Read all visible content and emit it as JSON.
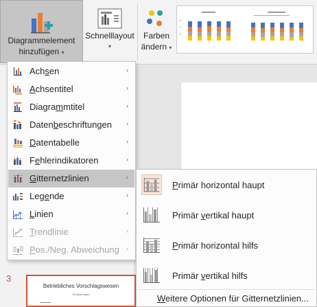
{
  "ribbon": {
    "add_element": {
      "line1": "Diagrammelement",
      "line2": "hinzufügen"
    },
    "quick_layout": {
      "line1": "Schnelllayout"
    },
    "change_colors": {
      "line1": "Farben",
      "line2": "ändern"
    },
    "colors": {
      "accent": "#d35230",
      "active_bg": "#c6c6c6",
      "blue": "#4472c4",
      "orange": "#ed7d31",
      "gray": "#a5a5a5",
      "yellow": "#ffc000",
      "teal": "#2e9f9f"
    }
  },
  "menu": {
    "items": [
      {
        "pre": "Ach",
        "u": "s",
        "post": "en",
        "icon": "axes-icon",
        "enabled": true
      },
      {
        "pre": "",
        "u": "A",
        "post": "chsentitel",
        "icon": "axis-titles-icon",
        "enabled": true
      },
      {
        "pre": "Diagra",
        "u": "m",
        "post": "mtitel",
        "icon": "chart-title-icon",
        "enabled": true
      },
      {
        "pre": "Daten",
        "u": "b",
        "post": "eschriftungen",
        "icon": "data-labels-icon",
        "enabled": true
      },
      {
        "pre": "",
        "u": "D",
        "post": "atentabelle",
        "icon": "data-table-icon",
        "enabled": true
      },
      {
        "pre": "F",
        "u": "e",
        "post": "hlerindikatoren",
        "icon": "error-bars-icon",
        "enabled": true
      },
      {
        "pre": "",
        "u": "G",
        "post": "itternetzlinien",
        "icon": "gridlines-icon",
        "enabled": true,
        "active": true
      },
      {
        "pre": "Leg",
        "u": "e",
        "post": "nde",
        "icon": "legend-icon",
        "enabled": true
      },
      {
        "pre": "",
        "u": "L",
        "post": "inien",
        "icon": "lines-icon",
        "enabled": true
      },
      {
        "pre": "",
        "u": "T",
        "post": "rendlinie",
        "icon": "trendline-icon",
        "enabled": false
      },
      {
        "pre": "",
        "u": "P",
        "post": "os./Neg. Abweichung",
        "icon": "up-down-bars-icon",
        "enabled": false
      }
    ]
  },
  "submenu": {
    "items": [
      {
        "pre": "",
        "u": "P",
        "post": "rimär horizontal haupt",
        "icon": "primary-major-horizontal-icon"
      },
      {
        "pre": "Primär ",
        "u": "v",
        "post": "ertikal haupt",
        "icon": "primary-major-vertical-icon"
      },
      {
        "pre": "",
        "u": "P",
        "post": "rimär horizontal hilfs",
        "icon": "primary-minor-horizontal-icon"
      },
      {
        "pre": "Primär ",
        "u": "v",
        "post": "ertikal hilfs",
        "icon": "primary-minor-vertical-icon"
      }
    ],
    "more": {
      "pre": "",
      "u": "W",
      "post": "eitere Optionen für Gitternetzlinien..."
    }
  },
  "slides": {
    "number": "3",
    "thumb_title": "Betriebliches Vorschlagswesen",
    "thumb_subtitle": "Einsparungen"
  }
}
